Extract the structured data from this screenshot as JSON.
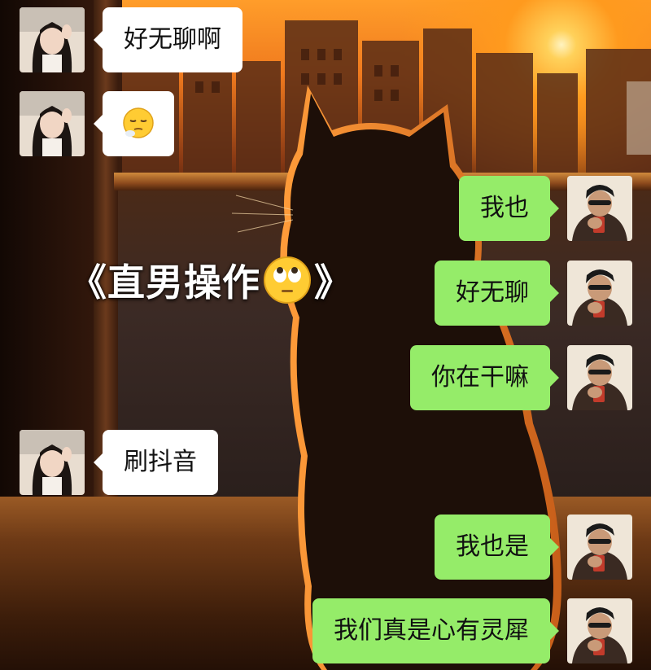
{
  "overlay": {
    "title_text": "《直男操作",
    "title_end": "》",
    "title_emoji_icon": "eye-roll-emoji"
  },
  "chat": {
    "colors": {
      "incoming_bubble": "#ffffff",
      "outgoing_bubble": "#95ec69"
    },
    "messages": [
      {
        "side": "incoming",
        "sender": "girl",
        "text": "好无聊啊"
      },
      {
        "side": "incoming",
        "sender": "girl",
        "text": "",
        "emoji": "pensive-emoji"
      },
      {
        "side": "outgoing",
        "sender": "boy",
        "text": "我也"
      },
      {
        "side": "outgoing",
        "sender": "boy",
        "text": "好无聊"
      },
      {
        "side": "outgoing",
        "sender": "boy",
        "text": "你在干嘛"
      },
      {
        "side": "incoming",
        "sender": "girl",
        "text": "刷抖音"
      },
      {
        "side": "outgoing",
        "sender": "boy",
        "text": "我也是"
      },
      {
        "side": "outgoing",
        "sender": "boy",
        "text": "我们真是心有灵犀"
      }
    ]
  }
}
